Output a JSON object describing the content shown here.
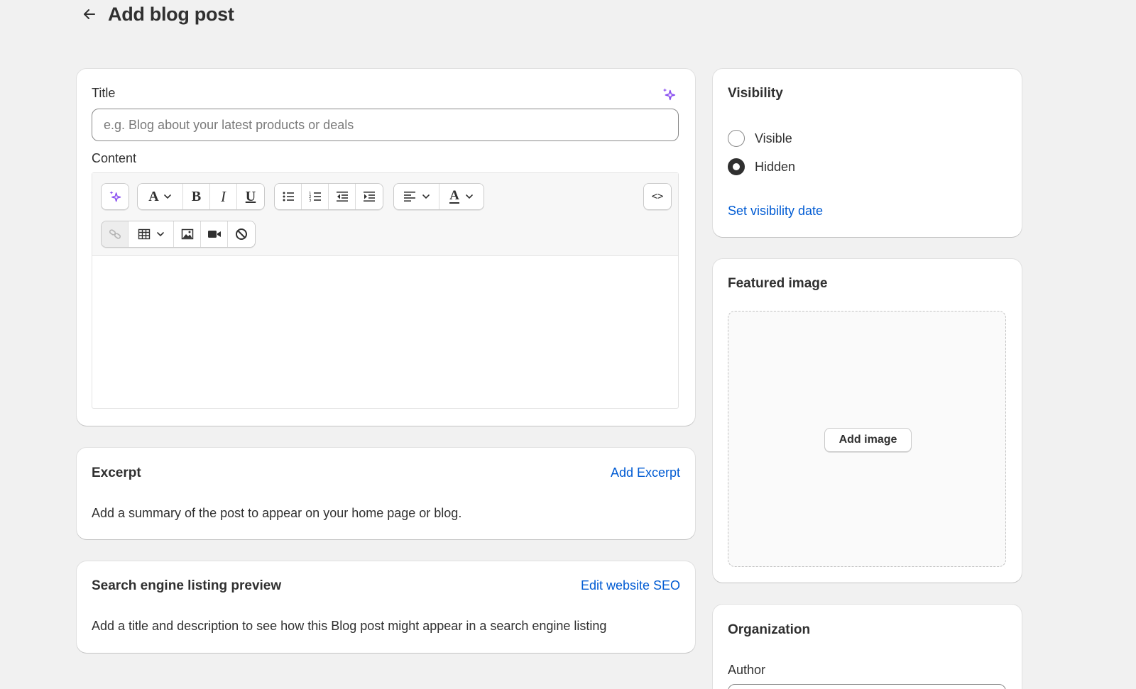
{
  "header": {
    "title": "Add blog post",
    "back_icon": "arrow-left-icon"
  },
  "main_card": {
    "title_label": "Title",
    "title_placeholder": "e.g. Blog about your latest products or deals",
    "title_value": "",
    "content_label": "Content",
    "ai_icon": "sparkle-icon",
    "toolbar": {
      "row1": [
        "ai-generate",
        "font-style",
        "bold",
        "italic",
        "underline",
        "bulleted-list",
        "numbered-list",
        "outdent",
        "indent",
        "align",
        "text-color",
        "html-source"
      ],
      "row2": [
        "link",
        "table",
        "image",
        "video",
        "clear-formatting"
      ],
      "html_source_label": "<>"
    },
    "content_value": ""
  },
  "excerpt": {
    "heading": "Excerpt",
    "action": "Add Excerpt",
    "description": "Add a summary of the post to appear on your home page or blog."
  },
  "seo": {
    "heading": "Search engine listing preview",
    "action": "Edit website SEO",
    "description": "Add a title and description to see how this Blog post might appear in a search engine listing"
  },
  "visibility": {
    "heading": "Visibility",
    "options": [
      {
        "label": "Visible",
        "checked": false
      },
      {
        "label": "Hidden",
        "checked": true
      }
    ],
    "action": "Set visibility date"
  },
  "featured_image": {
    "heading": "Featured image",
    "button": "Add image"
  },
  "organization": {
    "heading": "Organization",
    "author_label": "Author"
  },
  "colors": {
    "background": "#f1f1f1",
    "link": "#005bd3",
    "ai_accent": "#8a4ff0",
    "text": "#303030"
  }
}
